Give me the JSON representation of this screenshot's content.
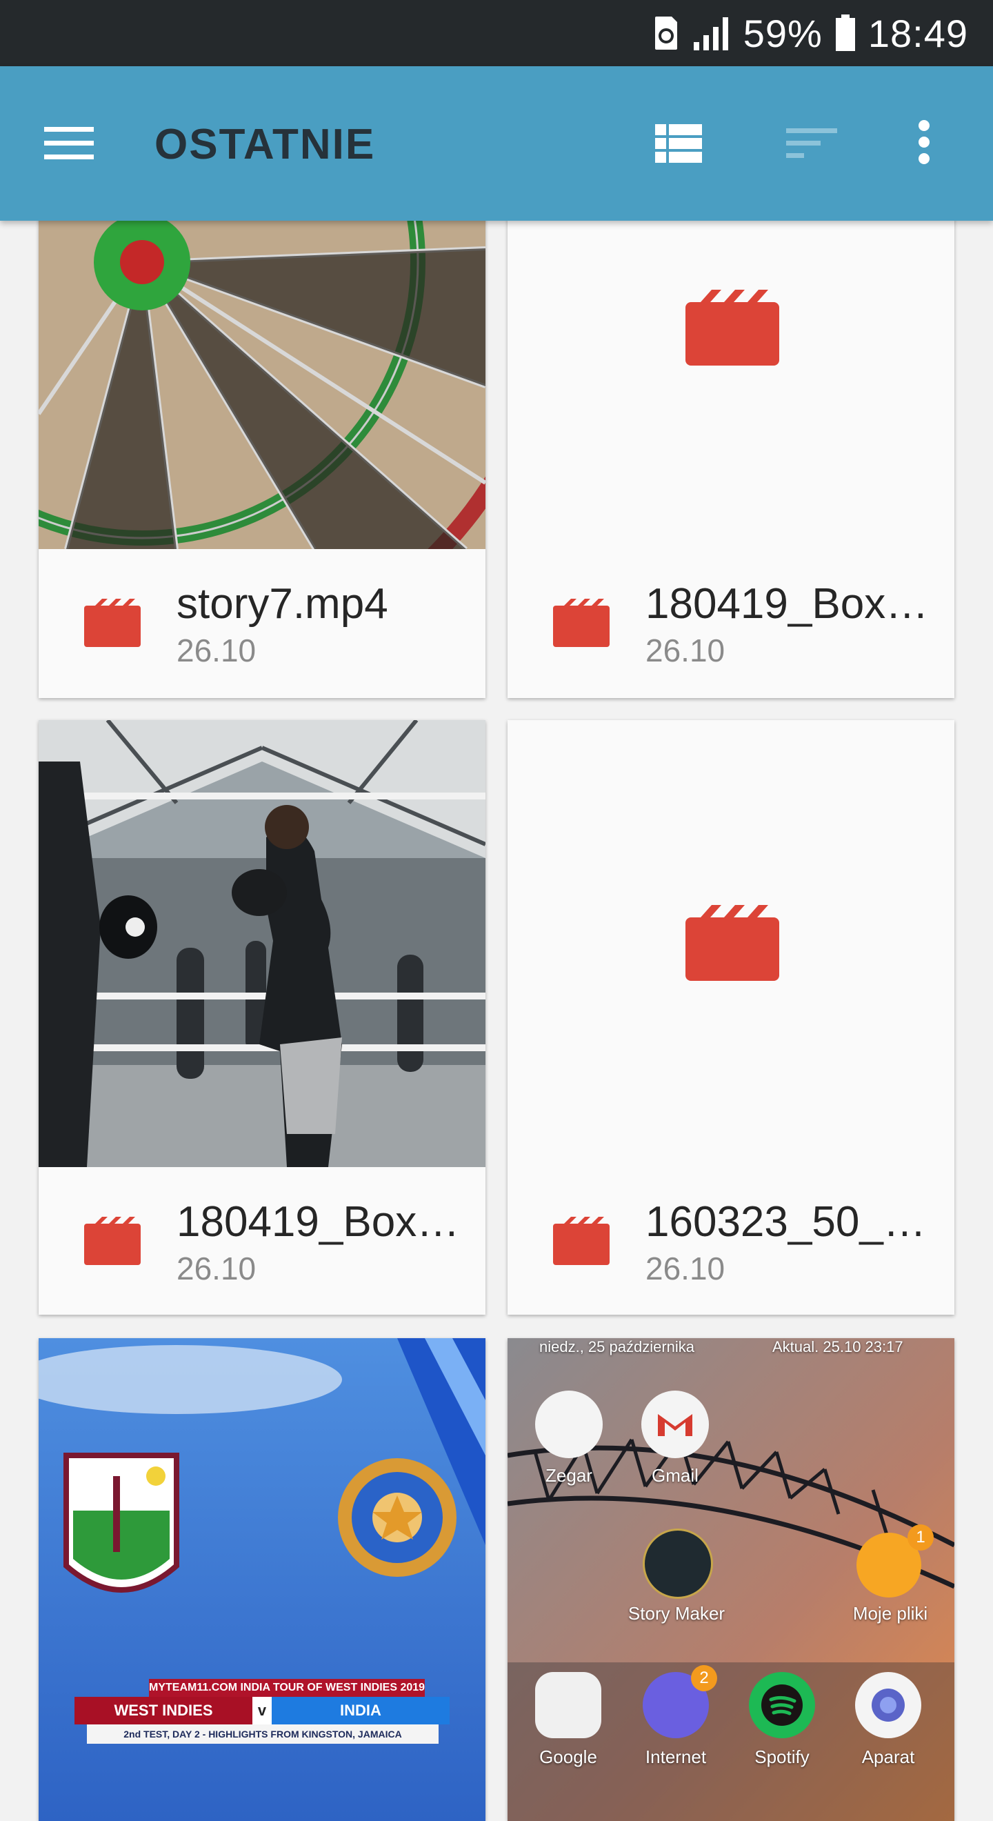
{
  "status_bar": {
    "battery_percent": "59%",
    "time": "18:49"
  },
  "app_bar": {
    "title": "OSTATNIE",
    "icons": [
      "menu-icon",
      "list-view-icon",
      "sort-icon",
      "more-vert-icon"
    ]
  },
  "files": [
    {
      "name": "story7.mp4",
      "date": "26.10",
      "thumbnail": "darts-photo",
      "type_icon": "video-icon"
    },
    {
      "name": "180419_Box…",
      "date": "26.10",
      "thumbnail": "video-placeholder",
      "type_icon": "video-icon"
    },
    {
      "name": "180419_Box…",
      "date": "26.10",
      "thumbnail": "boxing-photo",
      "type_icon": "video-icon"
    },
    {
      "name": "160323_50_…",
      "date": "26.10",
      "thumbnail": "video-placeholder",
      "type_icon": "video-icon"
    },
    {
      "thumbnail": "cricket-graphic"
    },
    {
      "thumbnail": "homescreen-screenshot"
    }
  ],
  "cricket_thumb": {
    "banner_top": "MYTEAM11.COM INDIA TOUR OF WEST INDIES 2019",
    "team_left": "WEST INDIES",
    "vs": "v",
    "team_right": "INDIA",
    "subtitle": "2nd TEST, DAY 2 - HIGHLIGHTS FROM KINGSTON, JAMAICA"
  },
  "homescreen_thumb": {
    "date_text": "niedz., 25 października",
    "updated_text": "Aktual. 25.10 23:17",
    "apps": [
      {
        "label": "Zegar"
      },
      {
        "label": "Gmail"
      },
      {
        "label": "Story Maker"
      },
      {
        "label": "Moje pliki",
        "badge": "1"
      },
      {
        "label": "Google"
      },
      {
        "label": "Internet",
        "badge": "2"
      },
      {
        "label": "Spotify"
      },
      {
        "label": "Aparat"
      }
    ]
  },
  "colors": {
    "app_bar": "#4a9ec2",
    "status_bar": "#25292c",
    "video_icon": "#dc4437",
    "title_text": "#26323a"
  }
}
